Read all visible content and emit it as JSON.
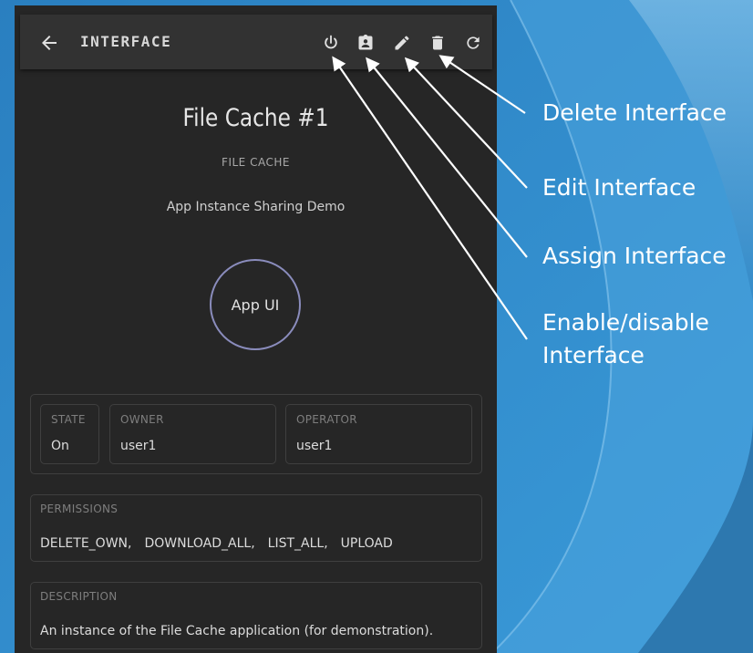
{
  "appbar": {
    "title": "INTERFACE",
    "back_icon": "arrow-back-icon",
    "actions": [
      {
        "name": "power-icon",
        "label": "Enable/disable Interface"
      },
      {
        "name": "assignment-icon",
        "label": "Assign Interface"
      },
      {
        "name": "edit-icon",
        "label": "Edit Interface"
      },
      {
        "name": "delete-icon",
        "label": "Delete Interface"
      },
      {
        "name": "refresh-icon",
        "label": ""
      }
    ]
  },
  "interface": {
    "title": "File Cache #1",
    "type": "FILE CACHE",
    "app": "App Instance Sharing Demo",
    "app_ui_label": "App UI"
  },
  "fields": {
    "state": {
      "label": "STATE",
      "value": "On"
    },
    "owner": {
      "label": "OWNER",
      "value": "user1"
    },
    "operator": {
      "label": "OPERATOR",
      "value": "user1"
    }
  },
  "permissions": {
    "label": "PERMISSIONS",
    "items": [
      "DELETE_OWN,",
      "DOWNLOAD_ALL,",
      "LIST_ALL,",
      "UPLOAD"
    ]
  },
  "description": {
    "label": "DESCRIPTION",
    "text": "An instance of the File Cache application (for demonstration)."
  },
  "callouts": {
    "delete": "Delete Interface",
    "edit": "Edit Interface",
    "assign": "Assign Interface",
    "enable": "Enable/disable Interface"
  },
  "colors": {
    "background": "#2f86c4",
    "panel": "#262626",
    "appbar": "#323232",
    "app_ui_ring": "#8a8cbc"
  }
}
